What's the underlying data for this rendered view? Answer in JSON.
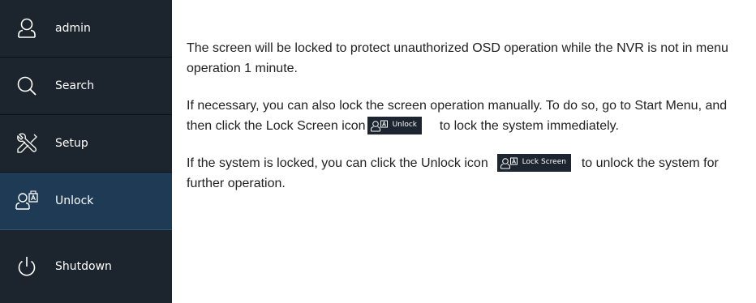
{
  "menu": {
    "items": [
      {
        "label": "admin",
        "icon": "user-icon"
      },
      {
        "label": "Search",
        "icon": "search-icon"
      },
      {
        "label": "Setup",
        "icon": "wrench-screwdriver-icon"
      },
      {
        "label": "Unlock",
        "icon": "user-lock-icon",
        "active": true
      },
      {
        "label": "Shutdown",
        "icon": "power-icon"
      }
    ]
  },
  "doc": {
    "para1": "The screen will be locked to protect unauthorized OSD operation while the NVR is not in menu operation 1 minute.",
    "para2_before": "If necessary, you can also lock the screen operation manually. To do so, go to Start Menu, and then click the Lock Screen icon",
    "para2_button": "Unlock",
    "para2_after": "to lock the system immediately.",
    "para3_before": "If the system is locked, you can click the Unlock icon",
    "para3_button": "Lock Screen",
    "para3_after": "to unlock the system for further operation."
  },
  "colors": {
    "menu_bg": "#1c252e",
    "menu_active_bg": "#1e3a55",
    "text": "#222222"
  }
}
